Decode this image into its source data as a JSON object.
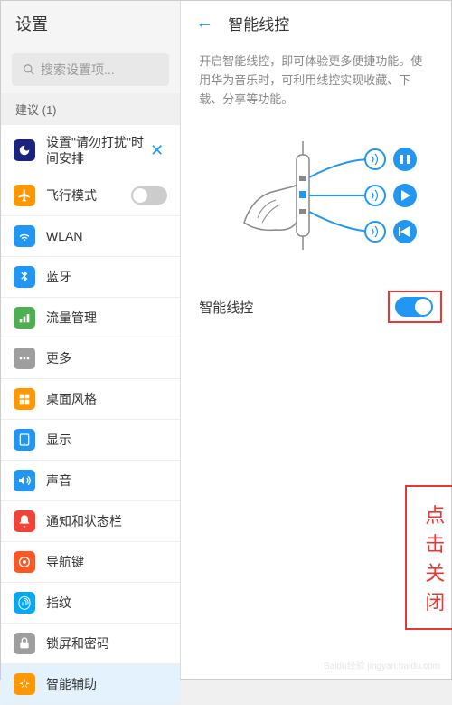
{
  "left": {
    "title": "设置",
    "search_placeholder": "搜索设置项...",
    "suggestion_header": "建议 (1)",
    "suggestion_text": "设置\"请勿打扰\"时间安排",
    "items": [
      {
        "label": "飞行模式",
        "color": "#ff9800",
        "has_toggle": true
      },
      {
        "label": "WLAN",
        "color": "#2196f3"
      },
      {
        "label": "蓝牙",
        "color": "#2196f3"
      },
      {
        "label": "流量管理",
        "color": "#4caf50"
      },
      {
        "label": "更多",
        "color": "#9e9e9e"
      }
    ],
    "items2": [
      {
        "label": "桌面风格",
        "color": "#ff9800"
      },
      {
        "label": "显示",
        "color": "#2196f3"
      },
      {
        "label": "声音",
        "color": "#2196f3"
      },
      {
        "label": "通知和状态栏",
        "color": "#f44336"
      },
      {
        "label": "导航键",
        "color": "#ff5722"
      }
    ],
    "items3": [
      {
        "label": "指纹",
        "color": "#03a9f4"
      },
      {
        "label": "锁屏和密码",
        "color": "#9e9e9e"
      },
      {
        "label": "智能辅助",
        "color": "#ff9800",
        "selected": true
      }
    ]
  },
  "right": {
    "title": "智能线控",
    "description": "开启智能线控，即可体验更多便捷功能。使用华为音乐时，可利用线控实现收藏、下载、分享等功能。",
    "toggle_label": "智能线控"
  },
  "annotation": {
    "text": "点击关闭"
  },
  "watermark": "Baidu经验 jingyan.baidu.com"
}
